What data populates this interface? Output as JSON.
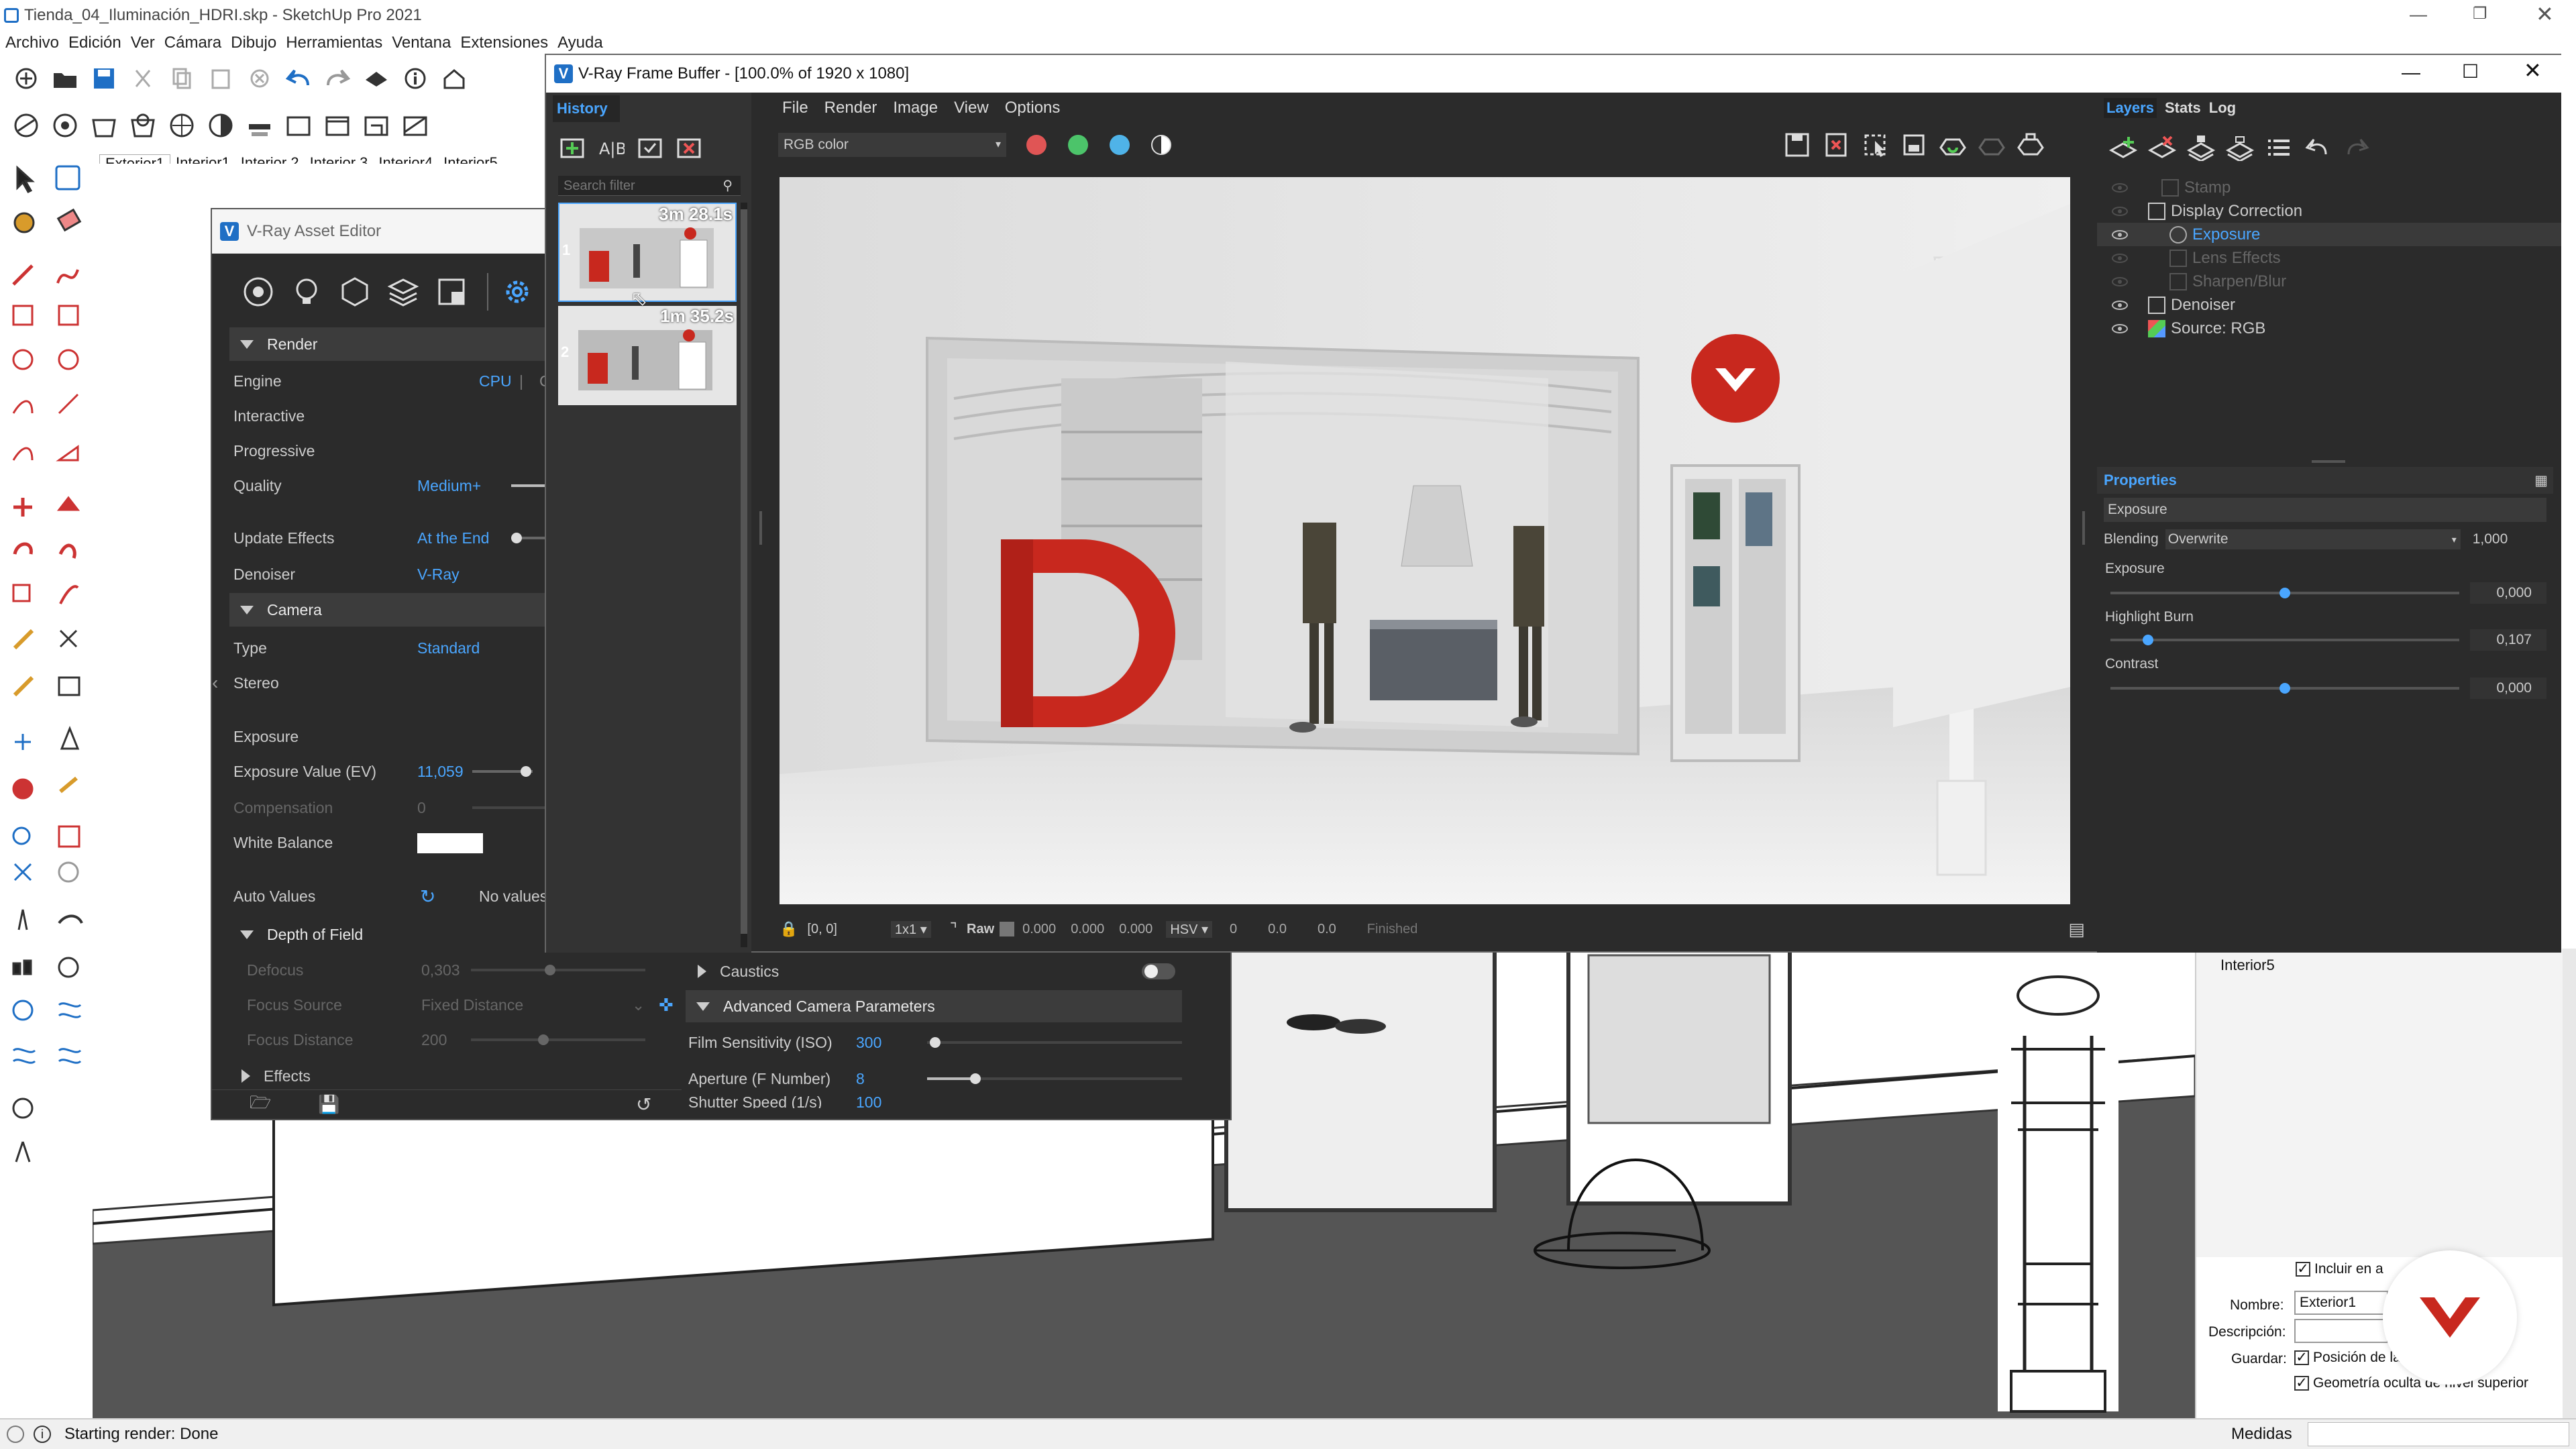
{
  "app": {
    "title": "Tienda_04_Iluminación_HDRI.skp - SketchUp Pro 2021",
    "menu": [
      "Archivo",
      "Edición",
      "Ver",
      "Cámara",
      "Dibujo",
      "Herramientas",
      "Ventana",
      "Extensiones",
      "Ayuda"
    ],
    "scene_tabs": [
      "Exterior1",
      "Interior1",
      "Interior 2",
      "Interior 3",
      "Interior4",
      "Interior5"
    ],
    "status_text": "Starting render: Done",
    "measures_label": "Medidas"
  },
  "scenes_panel": {
    "list_item": "Interior5",
    "include_label": "Incluir en a",
    "name_label": "Nombre:",
    "name_value": "Exterior1",
    "description_label": "Descripción:",
    "save_label": "Guardar:",
    "camera_pos_label": "Posición de la cáma",
    "hidden_geo_label": "Geometría oculta de nivel superior"
  },
  "asset_editor": {
    "title": "V-Ray Asset Editor",
    "render_header": "Render",
    "engine_label": "Engine",
    "engine_value": "CPU",
    "engine_value2": "C",
    "interactive_label": "Interactive",
    "progressive_label": "Progressive",
    "quality_label": "Quality",
    "quality_value": "Medium+",
    "update_effects_label": "Update Effects",
    "update_effects_value": "At the End",
    "denoiser_label": "Denoiser",
    "denoiser_value": "V-Ray",
    "camera_header": "Camera",
    "type_label": "Type",
    "type_value": "Standard",
    "stereo_label": "Stereo",
    "exposure_label": "Exposure",
    "ev_label": "Exposure Value (EV)",
    "ev_value": "11,059",
    "compensation_label": "Compensation",
    "compensation_value": "0",
    "wb_label": "White Balance",
    "auto_label": "Auto Values",
    "auto_value": "No values a",
    "dof_header": "Depth of Field",
    "defocus_label": "Defocus",
    "defocus_value": "0,303",
    "focus_source_label": "Focus Source",
    "focus_source_value": "Fixed Distance",
    "focus_distance_label": "Focus Distance",
    "focus_distance_value": "200",
    "effects_header": "Effects",
    "caustics_label": "Caustics",
    "adv_camera_header": "Advanced Camera Parameters",
    "iso_label": "Film Sensitivity (ISO)",
    "iso_value": "300",
    "aperture_label": "Aperture (F Number)",
    "aperture_value": "8",
    "shutter_label": "Shutter Speed (1/s)",
    "shutter_value": "100"
  },
  "vfb": {
    "title": "V-Ray Frame Buffer - [100.0% of 1920 x 1080]",
    "history_tab": "History",
    "search_placeholder": "Search filter",
    "history_items": [
      {
        "index": "1",
        "time": "3m 28.1s"
      },
      {
        "index": "2",
        "time": "1m 35.2s"
      }
    ],
    "menu": [
      "File",
      "Render",
      "Image",
      "View",
      "Options"
    ],
    "channel": "RGB color",
    "channel_colors": [
      "#e05555",
      "#4cc46a",
      "#4fb3e8"
    ],
    "status": {
      "coords": "[0, 0]",
      "zoom": "1x1",
      "raw_label": "Raw",
      "r": "0.000",
      "g": "0.000",
      "b": "0.000",
      "colorspace": "HSV",
      "h": "0",
      "s": "0.0",
      "v": "0.0",
      "state": "Finished"
    },
    "right_tabs": [
      "Layers",
      "Stats",
      "Log"
    ],
    "layers": [
      {
        "name": "Stamp",
        "visible": false,
        "dim": true
      },
      {
        "name": "Display Correction",
        "visible": false,
        "dim": false
      },
      {
        "name": "Exposure",
        "visible": true,
        "dim": false,
        "selected": true
      },
      {
        "name": "Lens Effects",
        "visible": false,
        "dim": true
      },
      {
        "name": "Sharpen/Blur",
        "visible": false,
        "dim": true
      },
      {
        "name": "Denoiser",
        "visible": true,
        "dim": false
      },
      {
        "name": "Source: RGB",
        "visible": true,
        "dim": false
      }
    ],
    "properties": {
      "header": "Properties",
      "layer_name": "Exposure",
      "blending_label": "Blending",
      "blending_value": "Overwrite",
      "blending_amount": "1,000",
      "exposure_label": "Exposure",
      "exposure_value": "0,000",
      "exposure_level": 0.5,
      "highlight_label": "Highlight Burn",
      "highlight_value": "0,107",
      "highlight_level": 0.107,
      "contrast_label": "Contrast",
      "contrast_value": "0,000",
      "contrast_level": 0.5
    }
  },
  "colors": {
    "accent": "#4aa6ff",
    "brand_red": "#c8281e",
    "panel_dark": "#2b2b2b"
  }
}
